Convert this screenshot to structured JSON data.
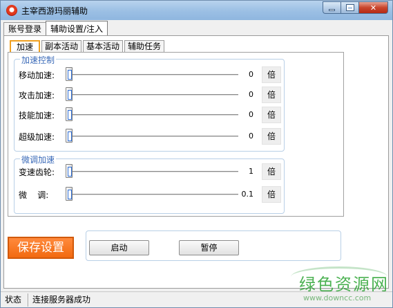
{
  "window": {
    "title": "主宰西游玛丽辅助"
  },
  "top_tabs": [
    {
      "label": "账号登录",
      "active": false
    },
    {
      "label": "辅助设置/注入",
      "active": true
    }
  ],
  "inner_tabs": [
    {
      "label": "加速",
      "active": true
    },
    {
      "label": "副本活动",
      "active": false
    },
    {
      "label": "基本活动",
      "active": false
    },
    {
      "label": "辅助任务",
      "active": false
    }
  ],
  "accel_group": {
    "title": "加速控制",
    "rows": [
      {
        "label": "移动加速:",
        "value": "0",
        "unit": "倍",
        "level": 0
      },
      {
        "label": "攻击加速:",
        "value": "0",
        "unit": "倍",
        "level": 0
      },
      {
        "label": "技能加速:",
        "value": "0",
        "unit": "倍",
        "level": 0
      },
      {
        "label": "超级加速:",
        "value": "0",
        "unit": "倍",
        "level": 0
      }
    ]
  },
  "fine_group": {
    "title": "微调加速",
    "rows": [
      {
        "label": "变速齿轮:",
        "value": "1",
        "unit": "倍",
        "level": 0
      },
      {
        "label": "微    调:",
        "value": "0.1",
        "unit": "倍",
        "level": 0
      }
    ]
  },
  "buttons": {
    "save": "保存设置",
    "start": "启动",
    "pause": "暂停"
  },
  "status": {
    "label": "状态",
    "message": "连接服务器成功"
  },
  "watermark": {
    "logo": "绿色资源网",
    "url": "www.downcc.com"
  },
  "colors": {
    "accent": "#f26a10",
    "group_title": "#3a6ab8",
    "tab_highlight": "#f0a020"
  }
}
